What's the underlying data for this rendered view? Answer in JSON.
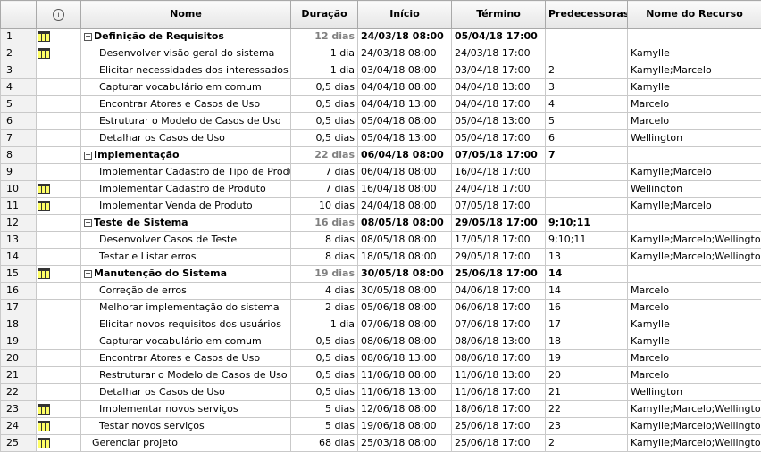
{
  "columns": {
    "indicator_icon": "info-icon",
    "name": "Nome",
    "duration": "Duração",
    "start": "Início",
    "finish": "Término",
    "predecessors": "Predecessoras",
    "resource": "Nome do Recurso"
  },
  "rows": [
    {
      "n": "1",
      "icon": true,
      "summary": true,
      "level": 0,
      "name": "Definição de Requisitos",
      "dur": "12 dias",
      "start": "24/03/18 08:00",
      "end": "05/04/18 17:00",
      "pred": "",
      "res": ""
    },
    {
      "n": "2",
      "icon": true,
      "summary": false,
      "level": 1,
      "name": "Desenvolver visão geral do sistema",
      "dur": "1 dia",
      "start": "24/03/18 08:00",
      "end": "24/03/18 17:00",
      "pred": "",
      "res": "Kamylle"
    },
    {
      "n": "3",
      "icon": false,
      "summary": false,
      "level": 1,
      "name": "Elicitar necessidades dos interessados",
      "dur": "1 dia",
      "start": "03/04/18 08:00",
      "end": "03/04/18 17:00",
      "pred": "2",
      "res": "Kamylle;Marcelo"
    },
    {
      "n": "4",
      "icon": false,
      "summary": false,
      "level": 1,
      "name": "Capturar vocabulário em comum",
      "dur": "0,5 dias",
      "start": "04/04/18 08:00",
      "end": "04/04/18 13:00",
      "pred": "3",
      "res": "Kamylle"
    },
    {
      "n": "5",
      "icon": false,
      "summary": false,
      "level": 1,
      "name": "Encontrar Atores e Casos de Uso",
      "dur": "0,5 dias",
      "start": "04/04/18 13:00",
      "end": "04/04/18 17:00",
      "pred": "4",
      "res": "Marcelo"
    },
    {
      "n": "6",
      "icon": false,
      "summary": false,
      "level": 1,
      "name": "Estruturar o Modelo de Casos de Uso",
      "dur": "0,5 dias",
      "start": "05/04/18 08:00",
      "end": "05/04/18 13:00",
      "pred": "5",
      "res": "Marcelo"
    },
    {
      "n": "7",
      "icon": false,
      "summary": false,
      "level": 1,
      "name": "Detalhar os Casos de Uso",
      "dur": "0,5 dias",
      "start": "05/04/18 13:00",
      "end": "05/04/18 17:00",
      "pred": "6",
      "res": "Wellington"
    },
    {
      "n": "8",
      "icon": false,
      "summary": true,
      "level": 0,
      "name": "Implementação",
      "dur": "22 dias",
      "start": "06/04/18 08:00",
      "end": "07/05/18 17:00",
      "pred": "7",
      "res": ""
    },
    {
      "n": "9",
      "icon": false,
      "summary": false,
      "level": 1,
      "name": "Implementar Cadastro de Tipo de Produto",
      "dur": "7 dias",
      "start": "06/04/18 08:00",
      "end": "16/04/18 17:00",
      "pred": "",
      "res": "Kamylle;Marcelo"
    },
    {
      "n": "10",
      "icon": true,
      "summary": false,
      "level": 1,
      "name": "Implementar Cadastro de Produto",
      "dur": "7 dias",
      "start": "16/04/18 08:00",
      "end": "24/04/18 17:00",
      "pred": "",
      "res": "Wellington"
    },
    {
      "n": "11",
      "icon": true,
      "summary": false,
      "level": 1,
      "name": "Implementar Venda de Produto",
      "dur": "10 dias",
      "start": "24/04/18 08:00",
      "end": "07/05/18 17:00",
      "pred": "",
      "res": "Kamylle;Marcelo"
    },
    {
      "n": "12",
      "icon": false,
      "summary": true,
      "level": 0,
      "name": "Teste de Sistema",
      "dur": "16 dias",
      "start": "08/05/18 08:00",
      "end": "29/05/18 17:00",
      "pred": "9;10;11",
      "res": ""
    },
    {
      "n": "13",
      "icon": false,
      "summary": false,
      "level": 1,
      "name": "Desenvolver Casos de Teste",
      "dur": "8 dias",
      "start": "08/05/18 08:00",
      "end": "17/05/18 17:00",
      "pred": "9;10;11",
      "res": "Kamylle;Marcelo;Wellington"
    },
    {
      "n": "14",
      "icon": false,
      "summary": false,
      "level": 1,
      "name": "Testar e Listar erros",
      "dur": "8 dias",
      "start": "18/05/18 08:00",
      "end": "29/05/18 17:00",
      "pred": "13",
      "res": "Kamylle;Marcelo;Wellington"
    },
    {
      "n": "15",
      "icon": true,
      "summary": true,
      "level": 0,
      "name": "Manutenção do Sistema",
      "dur": "19 dias",
      "start": "30/05/18 08:00",
      "end": "25/06/18 17:00",
      "pred": "14",
      "res": ""
    },
    {
      "n": "16",
      "icon": false,
      "summary": false,
      "level": 1,
      "name": "Correção de erros",
      "dur": "4 dias",
      "start": "30/05/18 08:00",
      "end": "04/06/18 17:00",
      "pred": "14",
      "res": "Marcelo"
    },
    {
      "n": "17",
      "icon": false,
      "summary": false,
      "level": 1,
      "name": "Melhorar implementação do sistema",
      "dur": "2 dias",
      "start": "05/06/18 08:00",
      "end": "06/06/18 17:00",
      "pred": "16",
      "res": "Marcelo"
    },
    {
      "n": "18",
      "icon": false,
      "summary": false,
      "level": 1,
      "name": "Elicitar novos requisitos dos usuários",
      "dur": "1 dia",
      "start": "07/06/18 08:00",
      "end": "07/06/18 17:00",
      "pred": "17",
      "res": "Kamylle"
    },
    {
      "n": "19",
      "icon": false,
      "summary": false,
      "level": 1,
      "name": "Capturar vocabulário em comum",
      "dur": "0,5 dias",
      "start": "08/06/18 08:00",
      "end": "08/06/18 13:00",
      "pred": "18",
      "res": "Kamylle"
    },
    {
      "n": "20",
      "icon": false,
      "summary": false,
      "level": 1,
      "name": "Encontrar Atores e Casos de Uso",
      "dur": "0,5 dias",
      "start": "08/06/18 13:00",
      "end": "08/06/18 17:00",
      "pred": "19",
      "res": "Marcelo"
    },
    {
      "n": "21",
      "icon": false,
      "summary": false,
      "level": 1,
      "name": "Restruturar o Modelo de Casos de Uso",
      "dur": "0,5 dias",
      "start": "11/06/18 08:00",
      "end": "11/06/18 13:00",
      "pred": "20",
      "res": "Marcelo"
    },
    {
      "n": "22",
      "icon": false,
      "summary": false,
      "level": 1,
      "name": "Detalhar os Casos de Uso",
      "dur": "0,5 dias",
      "start": "11/06/18 13:00",
      "end": "11/06/18 17:00",
      "pred": "21",
      "res": "Wellington"
    },
    {
      "n": "23",
      "icon": true,
      "summary": false,
      "level": 1,
      "name": "Implementar novos serviços",
      "dur": "5 dias",
      "start": "12/06/18 08:00",
      "end": "18/06/18 17:00",
      "pred": "22",
      "res": "Kamylle;Marcelo;Wellington"
    },
    {
      "n": "24",
      "icon": true,
      "summary": false,
      "level": 1,
      "name": "Testar novos serviços",
      "dur": "5 dias",
      "start": "19/06/18 08:00",
      "end": "25/06/18 17:00",
      "pred": "23",
      "res": "Kamylle;Marcelo;Wellington"
    },
    {
      "n": "25",
      "icon": true,
      "summary": false,
      "level": 0,
      "name": "Gerenciar projeto",
      "dur": "68 dias",
      "start": "25/03/18 08:00",
      "end": "25/06/18 17:00",
      "pred": "2",
      "res": "Kamylle;Marcelo;Wellington"
    }
  ]
}
